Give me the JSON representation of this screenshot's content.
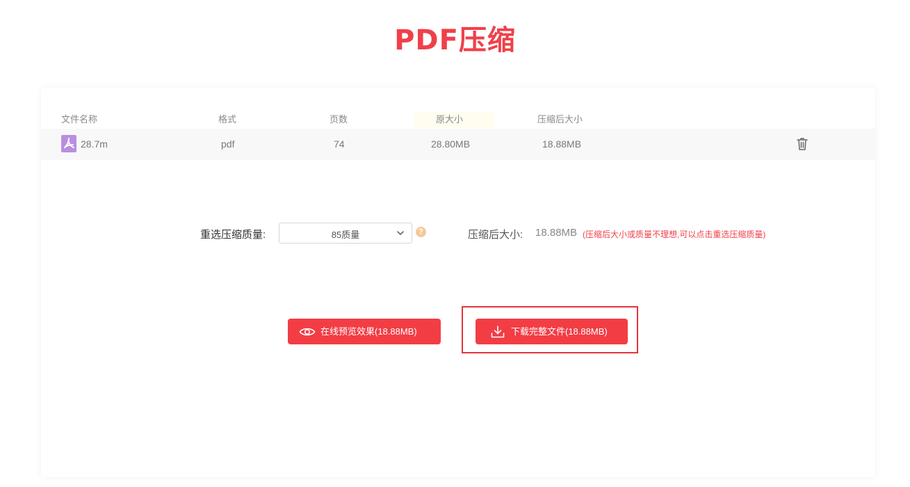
{
  "header": {
    "title": "PDF压缩"
  },
  "table": {
    "headers": [
      "文件名称",
      "格式",
      "页数",
      "原大小",
      "压缩后大小"
    ],
    "row": {
      "file_name": "28.7m",
      "format": "pdf",
      "pages": "74",
      "original_size": "28.80MB",
      "compressed_size": "18.88MB"
    }
  },
  "quality": {
    "label": "重选压缩质量:",
    "selected": "85质量",
    "help_glyph": "?",
    "size_label": "压缩后大小:",
    "size_value": "18.88MB",
    "hint": "(压缩后大小或质量不理想,可以点击重选压缩质量)"
  },
  "actions": {
    "preview_label": "在线预览效果(18.88MB)",
    "download_label": "下载完整文件(18.88MB)"
  },
  "colors": {
    "accent": "#f33d45",
    "title": "#f0404a",
    "highlight_border": "#e3353c",
    "pdf_icon": "#b98ee0"
  },
  "icons": {
    "file": "pdf-file-icon",
    "delete": "trash-icon",
    "help": "question-circle-icon",
    "preview": "eye-icon",
    "download": "download-icon",
    "dropdown": "chevron-down-icon"
  }
}
